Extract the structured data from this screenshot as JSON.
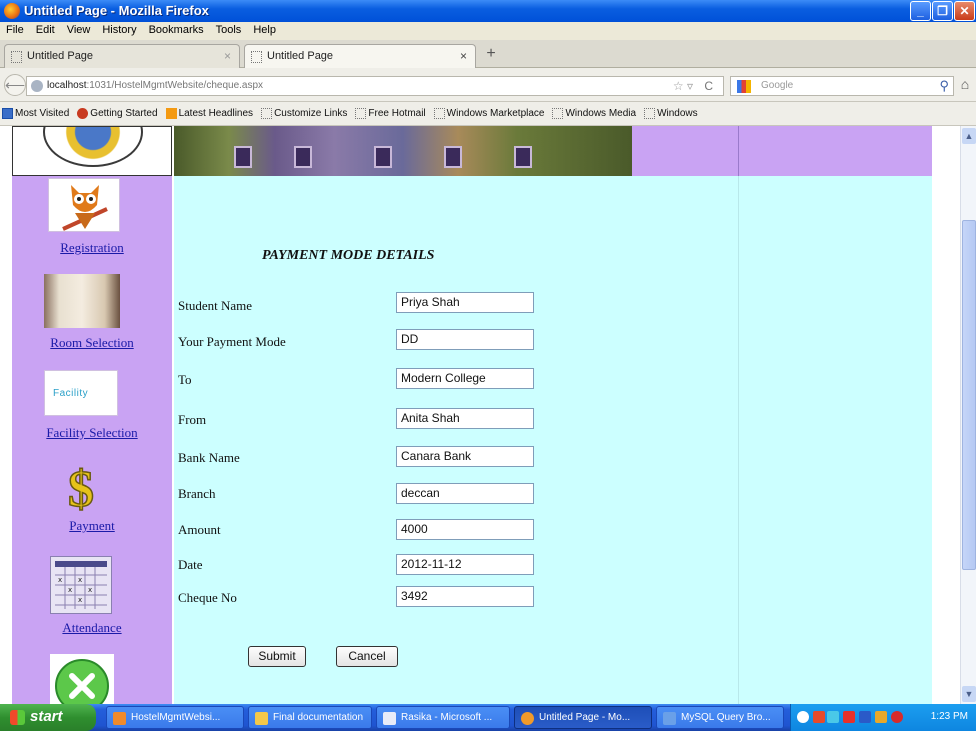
{
  "window": {
    "title": "Untitled Page - Mozilla Firefox"
  },
  "menu": [
    "File",
    "Edit",
    "View",
    "History",
    "Bookmarks",
    "Tools",
    "Help"
  ],
  "tabs": [
    {
      "label": "Untitled Page",
      "active": false
    },
    {
      "label": "Untitled Page",
      "active": true
    }
  ],
  "address": {
    "host": "localhost",
    "path": ":1031/HostelMgmtWebsite/cheque.aspx"
  },
  "search": {
    "placeholder": "Google"
  },
  "bookmarks": [
    "Most Visited",
    "Getting Started",
    "Latest Headlines",
    "Customize Links",
    "Free Hotmail",
    "Windows Marketplace",
    "Windows Media",
    "Windows"
  ],
  "sidebar": {
    "items": [
      {
        "label": "Registration",
        "icon": "owl-icon"
      },
      {
        "label": "Room Selection",
        "icon": "room-icon"
      },
      {
        "label": "Facility Selection",
        "icon": "facility-icon"
      },
      {
        "label": "Payment",
        "icon": "dollar-icon"
      },
      {
        "label": "Attendance",
        "icon": "calendar-icon"
      }
    ],
    "facility_logo_text": "Facility"
  },
  "form": {
    "heading": "PAYMENT MODE DETAILS",
    "fields": [
      {
        "label": "Student Name",
        "value": "Priya Shah"
      },
      {
        "label": "Your Payment Mode",
        "value": "DD"
      },
      {
        "label": "To",
        "value": "Modern College"
      },
      {
        "label": "From",
        "value": "Anita Shah"
      },
      {
        "label": "Bank Name",
        "value": "Canara Bank"
      },
      {
        "label": "Branch",
        "value": "deccan"
      },
      {
        "label": "Amount",
        "value": "4000"
      },
      {
        "label": "Date",
        "value": "2012-11-12"
      },
      {
        "label": "Cheque No",
        "value": "3492"
      }
    ],
    "submit_label": "Submit",
    "cancel_label": "Cancel"
  },
  "taskbar": {
    "start_label": "start",
    "tasks": [
      {
        "label": "HostelMgmtWebsi..."
      },
      {
        "label": "Final documentation"
      },
      {
        "label": "Rasika - Microsoft ..."
      },
      {
        "label": "Untitled Page - Mo..."
      },
      {
        "label": "MySQL Query Bro..."
      }
    ],
    "clock": "1:23 PM"
  },
  "colors": {
    "sidebar": "#c9a3f3",
    "main": "#ccffff",
    "link": "#1a1aa8"
  }
}
